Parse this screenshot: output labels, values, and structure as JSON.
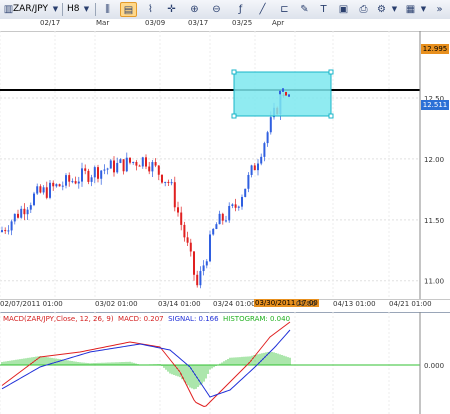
{
  "toolbar": {
    "symbol": "ZAR/JPY",
    "timeframe": "H8",
    "icons": [
      "dropdown-icon",
      "candle-chart-icon",
      "line-chart-icon",
      "crosshair-icon",
      "zoom-in-icon",
      "zoom-out-icon",
      "indicator-icon",
      "draw-line-icon",
      "text-icon",
      "image-icon",
      "settings-icon",
      "more-icon"
    ]
  },
  "top_axis": {
    "labels": [
      "02/17",
      "Mar",
      "03/09",
      "03/17",
      "03/25",
      "Apr"
    ]
  },
  "price_axis": {
    "labels": [
      "12.50",
      "12.00",
      "11.50",
      "11.00"
    ],
    "marker_top": "12.995",
    "marker_current": "12.511",
    "current_color": "#2b70d6",
    "marker_top_color": "#e8901e"
  },
  "time_axis": {
    "labels": [
      "02/07/2011 01:00",
      "03/02 01:00",
      "03/14 01:00",
      "03/24 01:00",
      "04/13 01:00",
      "04/21 01:00"
    ],
    "cursor_label": "03/30/2011 17:00",
    "cursor_tail": "01:00"
  },
  "indicator": {
    "title": "MACD(ZAR/JPY,Close, 12, 26, 9)",
    "macd_label": "MACD: 0.207",
    "signal_label": "SIGNAL: 0.166",
    "hist_label": "HISTOGRAM: 0.040",
    "zero_label": "0.000"
  },
  "colors": {
    "up_candle": "#2f5fe0",
    "down_candle": "#e02020",
    "selection_fill": "#7de8ee",
    "macd_line": "#e02020",
    "signal_line": "#2030d8",
    "histogram": "#30c030",
    "horizontal_line": "#000000"
  },
  "chart_data": {
    "type": "candlestick",
    "symbol": "ZAR/JPY",
    "timeframe": "H8",
    "ylim": [
      10.85,
      13.05
    ],
    "trend_points": [
      {
        "x": "02/07/2011 01:00",
        "y": 11.4
      },
      {
        "x": "02/16",
        "y": 11.7
      },
      {
        "x": "03/02 01:00",
        "y": 11.9
      },
      {
        "x": "03/09",
        "y": 12.0
      },
      {
        "x": "03/11",
        "y": 11.8
      },
      {
        "x": "03/14 01:00",
        "y": 11.2
      },
      {
        "x": "03/15",
        "y": 10.95
      },
      {
        "x": "03/18",
        "y": 11.45
      },
      {
        "x": "03/24 01:00",
        "y": 11.6
      },
      {
        "x": "03/28",
        "y": 11.95
      },
      {
        "x": "03/30/2011 17:00",
        "y": 12.55
      }
    ],
    "horizontal_line": 12.63,
    "macd": {
      "macd": 0.207,
      "signal": 0.166,
      "histogram": 0.04
    }
  }
}
